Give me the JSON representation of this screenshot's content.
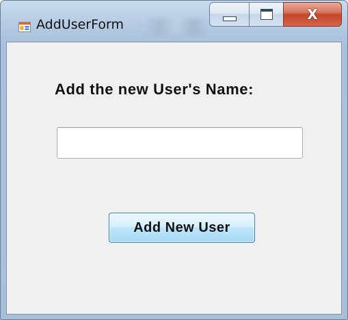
{
  "window": {
    "title": "AddUserForm",
    "close_glyph": "X",
    "app_icon": "windows-form-icon",
    "colors": {
      "frame": "#b7cde4",
      "client_background": "#f0f0f0",
      "close_button": "#c4452a",
      "button_accent": "#3c7fb1"
    }
  },
  "form": {
    "prompt_label": "Add the new User's Name:",
    "name_input_value": "",
    "add_button_label": "Add New User"
  }
}
